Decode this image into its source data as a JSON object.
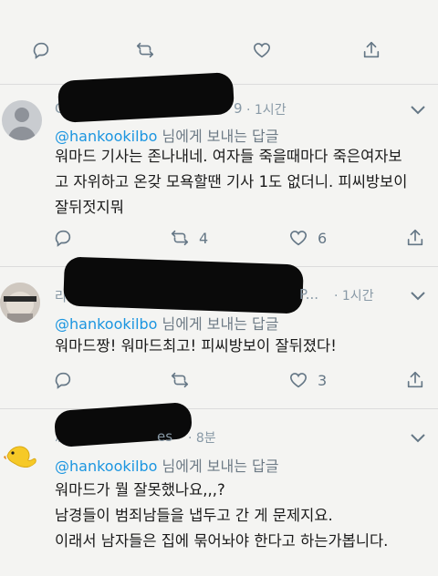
{
  "top": {
    "faded_text": "",
    "actions": {
      "reply_count": "",
      "retweet_count": "",
      "like_count": ""
    }
  },
  "tweets": [
    {
      "name_partial": "C",
      "time_partial": "9",
      "time": "· 1시간",
      "reply_handle": "@hankookilbo",
      "reply_suffix": " 님에게 보내는 답글",
      "lines": [
        "워마드 기사는 존나내네. 여자들 죽을때마다 죽은여자보",
        "고 자위하고 온갖 모욕할땐 기사 1도 없더니. 피씨방보이",
        "잘뒤젓지뭐"
      ],
      "reply_count": "",
      "retweet_count": "4",
      "like_count": "6"
    },
    {
      "name_partial": "라",
      "name_tail": "P...",
      "time": "· 1시간",
      "reply_handle": "@hankookilbo",
      "reply_suffix": " 님에게 보내는 답글",
      "lines": [
        "워마드짱! 워마드최고! 피씨방보이 잘뒤졌다!"
      ],
      "reply_count": "",
      "retweet_count": "",
      "like_count": "3"
    },
    {
      "name_partial": "깨",
      "name_tail": "es",
      "time": "· 8분",
      "reply_handle": "@hankookilbo",
      "reply_suffix": " 님에게 보내는 답글",
      "lines": [
        "워마드가 뭘 잘못했나요,,,?",
        "남경들이 범죄남들을 냅두고 간 게 문제지요.",
        "이래서 남자들은 집에 묶어놔야 한다고 하는가봅니다."
      ]
    }
  ],
  "icons": {
    "reply": "reply-icon",
    "retweet": "retweet-icon",
    "like": "heart-icon",
    "share": "share-icon",
    "menu": "chevron-down-icon"
  },
  "colors": {
    "link": "#1b95e0",
    "muted": "#8899a6",
    "icon": "#657786",
    "background": "#f4f4f2",
    "separator": "#dcdcdc"
  }
}
